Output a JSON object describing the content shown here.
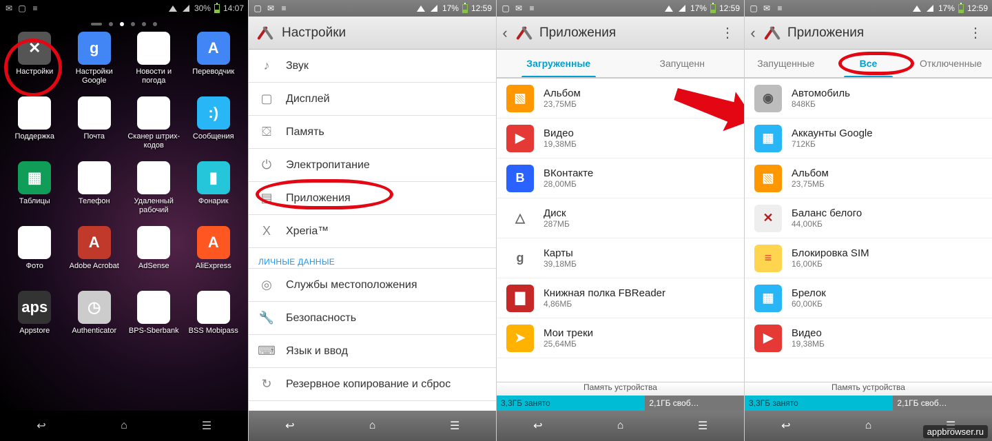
{
  "watermark": "appbrowser.ru",
  "panel1": {
    "status": {
      "battery": "30%",
      "time": "14:07"
    },
    "apps": [
      {
        "label": "Настройки",
        "cls": "ic-settings",
        "glyph": "✕"
      },
      {
        "label": "Настройки Google",
        "cls": "ic-gsettings",
        "glyph": "g"
      },
      {
        "label": "Новости и погода",
        "cls": "ic-news",
        "glyph": "≣"
      },
      {
        "label": "Переводчик",
        "cls": "ic-trans",
        "glyph": "A"
      },
      {
        "label": "Поддержка",
        "cls": "ic-support",
        "glyph": "Xc"
      },
      {
        "label": "Почта",
        "cls": "ic-mail",
        "glyph": "✉"
      },
      {
        "label": "Сканер штрих-кодов",
        "cls": "ic-barcode",
        "glyph": "║║"
      },
      {
        "label": "Сообщения",
        "cls": "ic-msg",
        "glyph": ":)"
      },
      {
        "label": "Таблицы",
        "cls": "ic-sheets",
        "glyph": "▦"
      },
      {
        "label": "Телефон",
        "cls": "ic-phone",
        "glyph": "✆"
      },
      {
        "label": "Удаленный рабочий",
        "cls": "ic-remote",
        "glyph": "⎚"
      },
      {
        "label": "Фонарик",
        "cls": "ic-flash",
        "glyph": "▮"
      },
      {
        "label": "Фото",
        "cls": "ic-photos",
        "glyph": "✦"
      },
      {
        "label": "Adobe Acrobat",
        "cls": "ic-adobe",
        "glyph": "A"
      },
      {
        "label": "AdSense",
        "cls": "ic-adsense",
        "glyph": "◧"
      },
      {
        "label": "AliExpress",
        "cls": "ic-ali",
        "glyph": "A"
      },
      {
        "label": "Appstore",
        "cls": "ic-appstore",
        "glyph": "aps"
      },
      {
        "label": "Authenticator",
        "cls": "ic-auth",
        "glyph": "◷"
      },
      {
        "label": "BPS-Sberbank",
        "cls": "ic-bps",
        "glyph": "₴"
      },
      {
        "label": "BSS Mobipass",
        "cls": "ic-bss",
        "glyph": "BSS"
      }
    ]
  },
  "panel2": {
    "status": {
      "battery": "17%",
      "time": "12:59"
    },
    "title": "Настройки",
    "items": [
      {
        "label": "Звук",
        "glyph": "♪"
      },
      {
        "label": "Дисплей",
        "glyph": "▢"
      },
      {
        "label": "Память",
        "glyph": "⛋"
      },
      {
        "label": "Электропитание",
        "glyph": "⏻"
      },
      {
        "label": "Приложения",
        "glyph": "▤"
      },
      {
        "label": "Xperia™",
        "glyph": "X"
      }
    ],
    "section": "ЛИЧНЫЕ ДАННЫЕ",
    "items2": [
      {
        "label": "Службы местоположения",
        "glyph": "◎"
      },
      {
        "label": "Безопасность",
        "glyph": "🔧"
      },
      {
        "label": "Язык и ввод",
        "glyph": "⌨"
      },
      {
        "label": "Резервное копирование и сброс",
        "glyph": "↻"
      }
    ]
  },
  "panel3": {
    "status": {
      "battery": "17%",
      "time": "12:59"
    },
    "title": "Приложения",
    "tabs": [
      "Загруженные",
      "Запущенн"
    ],
    "active_tab": 0,
    "apps": [
      {
        "name": "Альбом",
        "size": "23,75МБ",
        "bg": "#ff9800",
        "glyph": "▧"
      },
      {
        "name": "Видео",
        "size": "19,38МБ",
        "bg": "#e53935",
        "glyph": "▶"
      },
      {
        "name": "ВКонтакте",
        "size": "28,00МБ",
        "bg": "#2962ff",
        "glyph": "B"
      },
      {
        "name": "Диск",
        "size": "287МБ",
        "bg": "#ffffff",
        "glyph": "△",
        "fg": "#666"
      },
      {
        "name": "Карты",
        "size": "39,18МБ",
        "bg": "#ffffff",
        "glyph": "g",
        "fg": "#666"
      },
      {
        "name": "Книжная полка FBReader",
        "size": "4,86МБ",
        "bg": "#c62828",
        "glyph": "▇"
      },
      {
        "name": "Мои треки",
        "size": "25,64МБ",
        "bg": "#ffb300",
        "glyph": "➤"
      }
    ],
    "storage_caption": "Память устройства",
    "storage_used": "3,3ГБ занято",
    "storage_free": "2,1ГБ своб…"
  },
  "panel4": {
    "status": {
      "battery": "17%",
      "time": "12:59"
    },
    "title": "Приложения",
    "tabs": [
      "Запущенные",
      "Все",
      "Отключенные"
    ],
    "active_tab": 1,
    "apps": [
      {
        "name": "Автомобиль",
        "size": "848КБ",
        "bg": "#bdbdbd",
        "glyph": "◉",
        "fg": "#555"
      },
      {
        "name": "Аккаунты Google",
        "size": "712КБ",
        "bg": "#29b6f6",
        "glyph": "▦"
      },
      {
        "name": "Альбом",
        "size": "23,75МБ",
        "bg": "#ff9800",
        "glyph": "▧"
      },
      {
        "name": "Баланс белого",
        "size": "44,00КБ",
        "bg": "#eeeeee",
        "glyph": "✕",
        "fg": "#b71c1c"
      },
      {
        "name": "Блокировка SIM",
        "size": "16,00КБ",
        "bg": "#ffd54f",
        "glyph": "≡",
        "fg": "#e53935"
      },
      {
        "name": "Брелок",
        "size": "60,00КБ",
        "bg": "#29b6f6",
        "glyph": "▦"
      },
      {
        "name": "Видео",
        "size": "19,38МБ",
        "bg": "#e53935",
        "glyph": "▶"
      }
    ],
    "storage_caption": "Память устройства",
    "storage_used": "3,3ГБ занято",
    "storage_free": "2,1ГБ своб…"
  }
}
